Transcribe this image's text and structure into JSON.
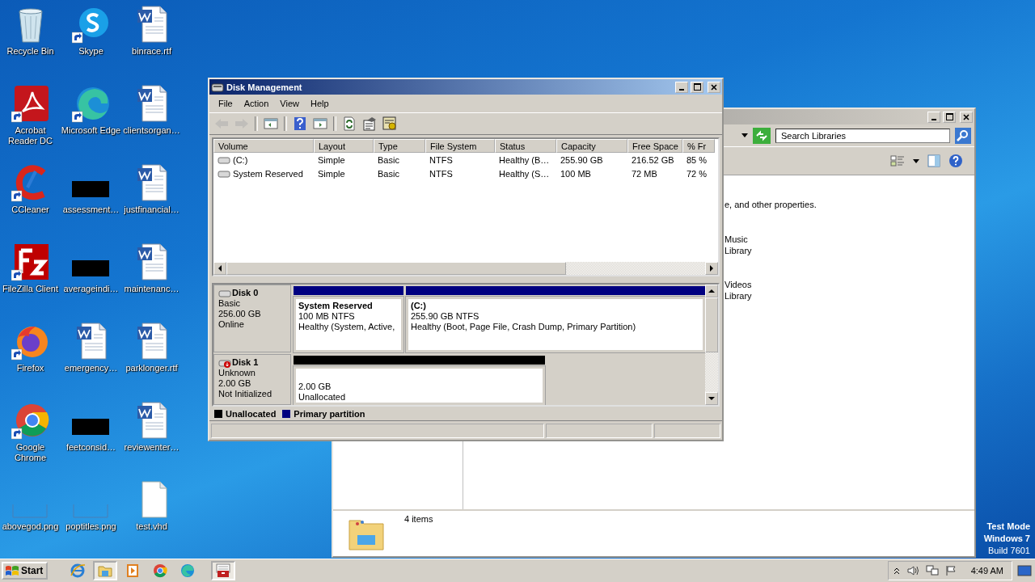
{
  "desktop_icons": [
    {
      "label": "Recycle Bin",
      "kind": "recycle",
      "shortcut": false
    },
    {
      "label": "Acrobat Reader DC",
      "kind": "acrobat",
      "shortcut": true
    },
    {
      "label": "CCleaner",
      "kind": "ccleaner",
      "shortcut": true
    },
    {
      "label": "FileZilla Client",
      "kind": "filezilla",
      "shortcut": true
    },
    {
      "label": "Firefox",
      "kind": "firefox",
      "shortcut": true
    },
    {
      "label": "Google Chrome",
      "kind": "chrome",
      "shortcut": true
    },
    {
      "label": "abovegod.png",
      "kind": "image",
      "shortcut": false
    },
    {
      "label": "Skype",
      "kind": "skype",
      "shortcut": true
    },
    {
      "label": "Microsoft Edge",
      "kind": "edge",
      "shortcut": true
    },
    {
      "label": "assessment…",
      "kind": "redacted",
      "shortcut": false
    },
    {
      "label": "averageindi…",
      "kind": "redacted",
      "shortcut": false
    },
    {
      "label": "emergency…",
      "kind": "word",
      "shortcut": false
    },
    {
      "label": "feetconsid…",
      "kind": "redacted",
      "shortcut": false
    },
    {
      "label": "poptitles.png",
      "kind": "image",
      "shortcut": false
    },
    {
      "label": "binrace.rtf",
      "kind": "word",
      "shortcut": false
    },
    {
      "label": "clientsorgan…",
      "kind": "word",
      "shortcut": false
    },
    {
      "label": "justfinancial…",
      "kind": "word",
      "shortcut": false
    },
    {
      "label": "maintenanc…",
      "kind": "word",
      "shortcut": false
    },
    {
      "label": "parklonger.rtf",
      "kind": "word",
      "shortcut": false
    },
    {
      "label": "reviewenter…",
      "kind": "word",
      "shortcut": false
    },
    {
      "label": "test.vhd",
      "kind": "blank",
      "shortcut": false
    }
  ],
  "explorer": {
    "search": {
      "placeholder": "Search Libraries"
    },
    "description": "e, and other properties.",
    "libraries": [
      {
        "name": "Music",
        "sub": "Library"
      },
      {
        "name": "Videos",
        "sub": "Library"
      }
    ],
    "status": "4 items"
  },
  "disk_management": {
    "title": "Disk Management",
    "menu": [
      "File",
      "Action",
      "View",
      "Help"
    ],
    "toolbar": [
      {
        "kind": "back",
        "disabled": true
      },
      {
        "kind": "forward",
        "disabled": true
      },
      {
        "kind": "show-tree",
        "disabled": false
      },
      {
        "kind": "help",
        "disabled": false
      },
      {
        "kind": "show-pane",
        "disabled": false
      },
      {
        "kind": "refresh",
        "disabled": false
      },
      {
        "kind": "properties",
        "disabled": false
      },
      {
        "kind": "settings",
        "disabled": false
      }
    ],
    "columns": [
      "Volume",
      "Layout",
      "Type",
      "File System",
      "Status",
      "Capacity",
      "Free Space",
      "% Fr"
    ],
    "volumes": [
      [
        "(C:)",
        "Simple",
        "Basic",
        "NTFS",
        "Healthy (B…",
        "255.90 GB",
        "216.52 GB",
        "85 %"
      ],
      [
        "System Reserved",
        "Simple",
        "Basic",
        "NTFS",
        "Healthy (S…",
        "100 MB",
        "72 MB",
        "72 %"
      ]
    ],
    "disks": [
      {
        "name": "Disk 0",
        "kind": "basic",
        "type": "Basic",
        "size": "256.00 GB",
        "state": "Online",
        "partitions": [
          {
            "name": "System Reserved",
            "size": "100 MB NTFS",
            "status": "Healthy (System, Active,",
            "kind": "primary"
          },
          {
            "name": "(C:)",
            "size": "255.90 GB NTFS",
            "status": "Healthy (Boot, Page File, Crash Dump, Primary Partition)",
            "kind": "primary"
          }
        ]
      },
      {
        "name": "Disk 1",
        "kind": "uninitialized",
        "type": "Unknown",
        "size": "2.00 GB",
        "state": "Not Initialized",
        "partitions": [
          {
            "size": "2.00 GB",
            "status": "Unallocated",
            "kind": "unallocated"
          }
        ]
      }
    ],
    "legend": [
      {
        "label": "Unallocated",
        "color": "#000000"
      },
      {
        "label": "Primary partition",
        "color": "#000080"
      }
    ]
  },
  "taskbar": {
    "start": "Start",
    "apps": [
      {
        "kind": "ie",
        "selected": false
      },
      {
        "kind": "explorer",
        "selected": true
      },
      {
        "kind": "media",
        "selected": false
      },
      {
        "kind": "chrome",
        "selected": false
      },
      {
        "kind": "edge",
        "selected": false
      },
      {
        "kind": "diskmgmt",
        "selected": true
      }
    ],
    "time": "4:49 AM"
  },
  "watermark_os": [
    "Test Mode",
    "Windows 7",
    "Build 7601"
  ]
}
